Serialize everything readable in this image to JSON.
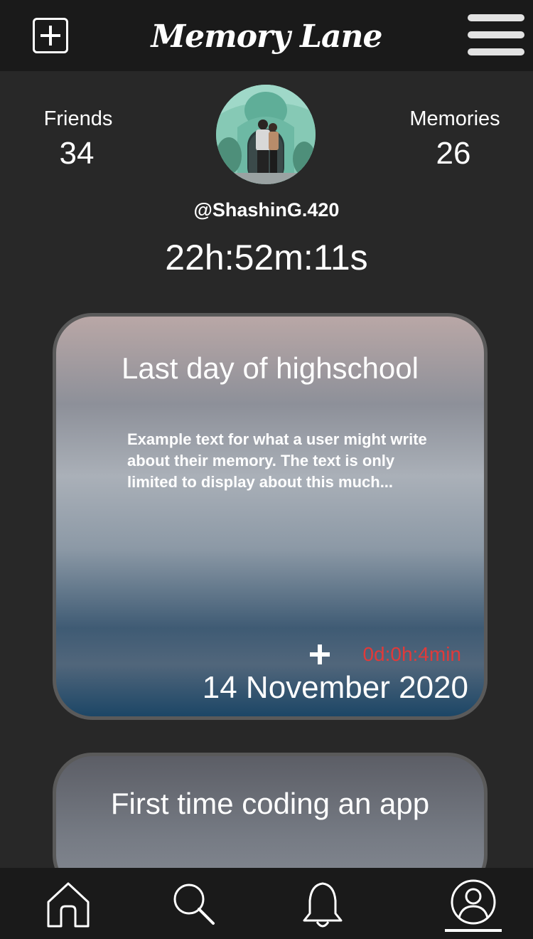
{
  "header": {
    "title": "Memory Lane",
    "add_icon": "plus-square-icon",
    "menu_icon": "hamburger-icon"
  },
  "profile": {
    "friends_label": "Friends",
    "friends_count": "34",
    "memories_label": "Memories",
    "memories_count": "26",
    "username": "@ShashinG.420",
    "timer": "22h:52m:11s"
  },
  "memories": [
    {
      "title": "Last day of highschool",
      "body": "Example text for what a user might write about their memory. The text is only limited to display about this much...",
      "duration": "0d:0h:4min",
      "date": "14 November 2020"
    },
    {
      "title": "First time coding an app"
    }
  ],
  "bottom_nav": {
    "items": [
      "home-icon",
      "search-icon",
      "bell-icon",
      "profile-icon"
    ],
    "active": "profile-icon"
  },
  "colors": {
    "background": "#282828",
    "bar": "#1a1a1a",
    "accent_red": "#e03a3a"
  }
}
